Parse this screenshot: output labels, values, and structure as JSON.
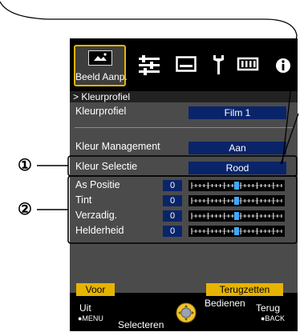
{
  "tabs": {
    "selected_label": "Beeld Aanp.",
    "icons": [
      "picture-icon",
      "settings-sliders-icon",
      "display-icon",
      "wrench-icon",
      "input-icon",
      "info-icon"
    ]
  },
  "breadcrumb": "> Kleurprofiel",
  "rows": {
    "kleurprofiel": {
      "label": "Kleurprofiel",
      "value": "Film 1"
    },
    "kleur_management": {
      "label": "Kleur Management",
      "value": "Aan"
    },
    "kleur_selectie": {
      "label": "Kleur Selectie",
      "value": "Rood"
    }
  },
  "sliders": [
    {
      "label": "As Positie",
      "value": "0",
      "level": 0.5
    },
    {
      "label": "Tint",
      "value": "0",
      "level": 0.5
    },
    {
      "label": "Verzadig.",
      "value": "0",
      "level": 0.5
    },
    {
      "label": "Helderheid",
      "value": "0",
      "level": 0.5
    }
  ],
  "footer": {
    "voor": "Voor",
    "terugzetten": "Terugzetten",
    "uit": "Uit",
    "menu": "●MENU",
    "selecteren": "Selecteren",
    "bedienen": "Bedienen",
    "terug": "Terug",
    "back": "●BACK"
  },
  "callouts": [
    "①",
    "②"
  ],
  "colors": {
    "accent": "#e6b400",
    "value_bg": "#0a246a",
    "panel": "#4b4b4b"
  }
}
